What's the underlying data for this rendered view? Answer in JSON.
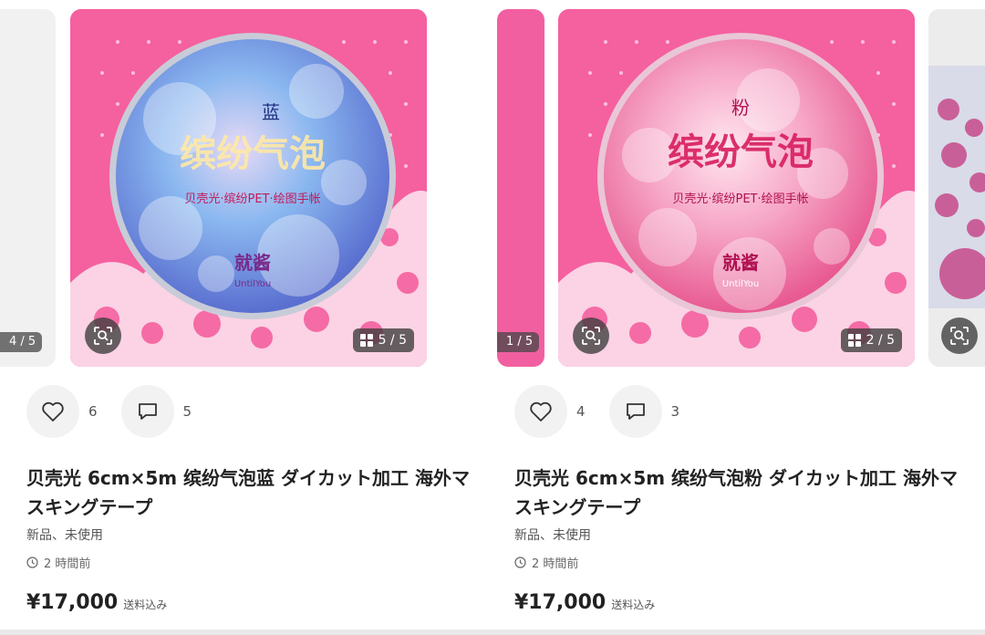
{
  "listings": [
    {
      "prev_counter": "4 / 5",
      "image_counter": "5 / 5",
      "image_label_color": "蓝",
      "image_title": "缤纷气泡",
      "image_subtitle": "贝壳光·缤纷PET·绘图手帐",
      "image_brand": "就酱",
      "image_brand_sub": "UntilYou",
      "likes": "6",
      "comments": "5",
      "title": "贝壳光 6cm×5m 缤纷气泡蓝 ダイカット加工 海外マスキングテープ",
      "condition": "新品、未使用",
      "time": "2 時間前",
      "price": "¥17,000",
      "shipping": "送料込み",
      "tape_color": "#7aa6e8"
    },
    {
      "prev_counter": "1 / 5",
      "image_counter": "2 / 5",
      "image_label_color": "粉",
      "image_title": "缤纷气泡",
      "image_subtitle": "贝壳光·缤纷PET·绘图手帐",
      "image_brand": "就酱",
      "image_brand_sub": "UntilYou",
      "likes": "4",
      "comments": "3",
      "title": "贝壳光 6cm×5m 缤纷气泡粉 ダイカット加工 海外マスキングテープ",
      "condition": "新品、未使用",
      "time": "2 時間前",
      "price": "¥17,000",
      "shipping": "送料込み",
      "tape_color": "#f49bc0"
    }
  ],
  "colors": {
    "background_pink": "#f5609f",
    "lace": "#fbd3e5"
  }
}
